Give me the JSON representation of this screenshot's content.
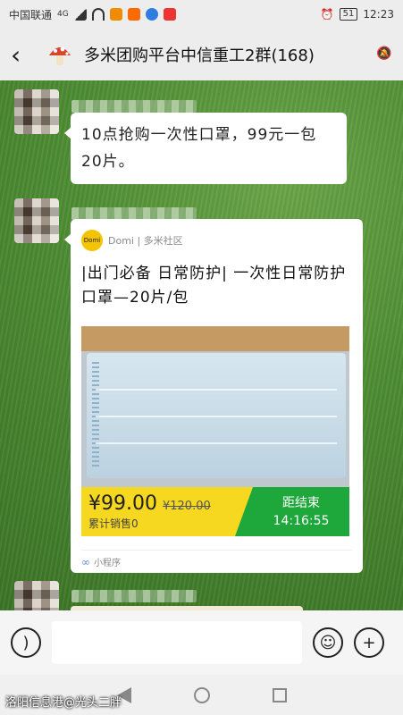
{
  "status_bar": {
    "carrier": "中国联通",
    "network": "4G",
    "battery": "51",
    "time": "12:23"
  },
  "header": {
    "title": "多米团购平台中信重工2群(168)"
  },
  "messages": {
    "text_message": "10点抢购一次性口罩，99元一包20片。",
    "card": {
      "source_logo_text": "Domi",
      "source_name": "Domi | 多米社区",
      "title": "|出门必备 日常防护| 一次性日常防护口罩—20片/包",
      "price": "¥99.00",
      "original_price": "¥120.00",
      "sold_label": "累计销售0",
      "countdown_label": "距结束",
      "countdown_time": "14:16:55",
      "footer_label": "小程序"
    }
  },
  "input_bar": {
    "placeholder": ""
  },
  "watermark": "洛阳信息港@光头二胖",
  "colors": {
    "price_bar": "#f6d820",
    "countdown_bg": "#1ea83b",
    "header_bg": "#ededed"
  },
  "icons": {
    "back": "chevron-left-icon",
    "mute": "bell-off-icon",
    "voice": "voice-icon",
    "emoji": "emoji-icon",
    "add": "plus-icon"
  }
}
